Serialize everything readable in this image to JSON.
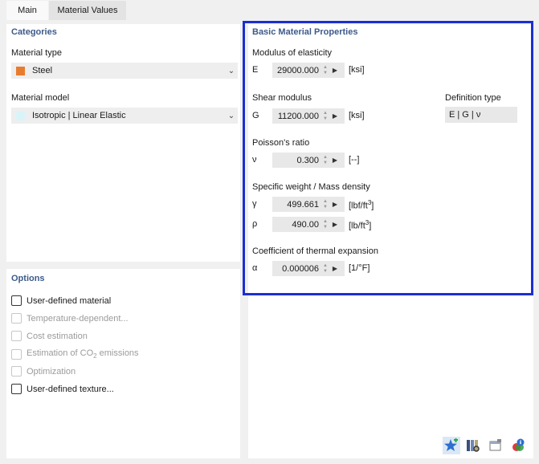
{
  "tabs": [
    {
      "label": "Main",
      "active": true
    },
    {
      "label": "Material Values",
      "active": false
    }
  ],
  "categories": {
    "title": "Categories",
    "material_type_label": "Material type",
    "material_type_value": "Steel",
    "material_type_color": "#e87c2e",
    "material_model_label": "Material model",
    "material_model_value": "Isotropic | Linear Elastic",
    "material_model_color": "#d9f4f8"
  },
  "options": {
    "title": "Options",
    "items": [
      {
        "label": "User-defined material",
        "enabled": true
      },
      {
        "label": "Temperature-dependent...",
        "enabled": false
      },
      {
        "label": "Cost estimation",
        "enabled": false
      },
      {
        "label": "Estimation of CO",
        "sub": "2",
        "suffix": " emissions",
        "enabled": false
      },
      {
        "label": "Optimization",
        "enabled": false
      },
      {
        "label": "User-defined texture...",
        "enabled": true
      }
    ]
  },
  "basic": {
    "title": "Basic Material Properties",
    "modulus_label": "Modulus of elasticity",
    "E": {
      "symbol": "E",
      "value": "29000.000",
      "unit": "[ksi]"
    },
    "shear_label": "Shear modulus",
    "G": {
      "symbol": "G",
      "value": "11200.000",
      "unit": "[ksi]"
    },
    "definition_type_label": "Definition type",
    "definition_type_value": "E | G | ν",
    "poisson_label": "Poisson's ratio",
    "nu": {
      "symbol": "ν",
      "value": "0.300",
      "unit": "[--]"
    },
    "weight_label": "Specific weight / Mass density",
    "gamma": {
      "symbol": "γ",
      "value": "499.661",
      "unit_base": "[lbf/ft",
      "unit_sup": "3",
      "unit_end": "]"
    },
    "rho": {
      "symbol": "ρ",
      "value": "490.00",
      "unit_base": "[lb/ft",
      "unit_sup": "3",
      "unit_end": "]"
    },
    "thermal_label": "Coefficient of thermal expansion",
    "alpha": {
      "symbol": "α",
      "value": "0.000006",
      "unit": "[1/°F]"
    }
  },
  "toolbar": {
    "icons": [
      "new-star-icon",
      "library-icon",
      "window-icon",
      "color-info-icon"
    ]
  },
  "colors": {
    "highlight": "#1b2ed2",
    "section_title": "#3d5a8a"
  }
}
